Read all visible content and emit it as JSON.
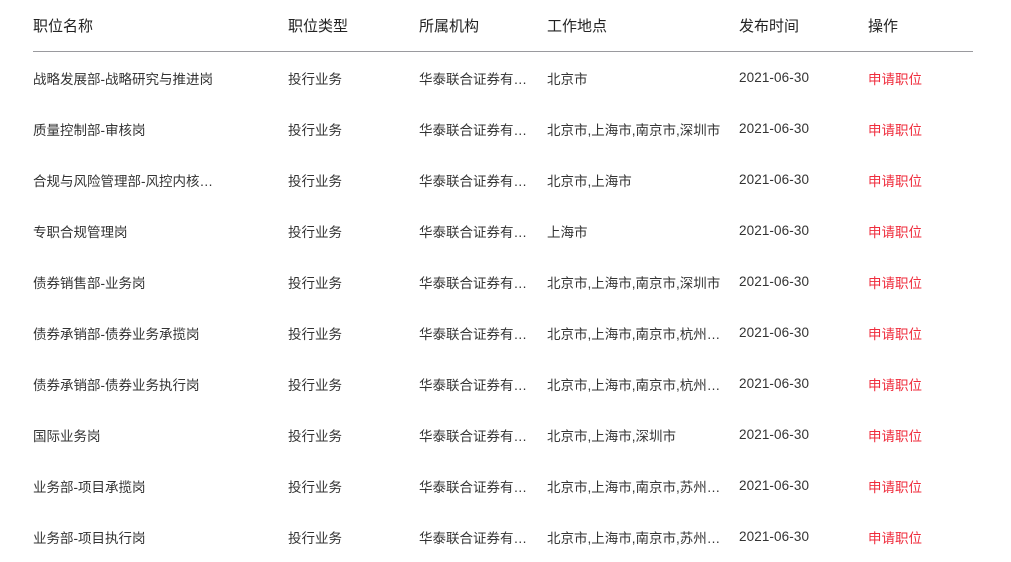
{
  "table": {
    "columns": [
      {
        "key": "title",
        "label": "职位名称"
      },
      {
        "key": "type",
        "label": "职位类型"
      },
      {
        "key": "org",
        "label": "所属机构"
      },
      {
        "key": "loc",
        "label": "工作地点"
      },
      {
        "key": "date",
        "label": "发布时间"
      },
      {
        "key": "action",
        "label": "操作"
      }
    ],
    "action_label": "申请职位",
    "accent_color": "#ef2c3c",
    "header_rule_color": "#9a9a9e",
    "rows": [
      {
        "title": "战略发展部-战略研究与推进岗",
        "type": "投行业务",
        "org": "华泰联合证券有…",
        "loc": "北京市",
        "date": "2021-06-30",
        "action": "申请职位"
      },
      {
        "title": "质量控制部-审核岗",
        "type": "投行业务",
        "org": "华泰联合证券有…",
        "loc": "北京市,上海市,南京市,深圳市",
        "date": "2021-06-30",
        "action": "申请职位"
      },
      {
        "title": "合规与风险管理部-风控内核…",
        "type": "投行业务",
        "org": "华泰联合证券有…",
        "loc": "北京市,上海市",
        "date": "2021-06-30",
        "action": "申请职位"
      },
      {
        "title": "专职合规管理岗",
        "type": "投行业务",
        "org": "华泰联合证券有…",
        "loc": "上海市",
        "date": "2021-06-30",
        "action": "申请职位"
      },
      {
        "title": "债券销售部-业务岗",
        "type": "投行业务",
        "org": "华泰联合证券有…",
        "loc": "北京市,上海市,南京市,深圳市",
        "date": "2021-06-30",
        "action": "申请职位"
      },
      {
        "title": "债券承销部-债券业务承揽岗",
        "type": "投行业务",
        "org": "华泰联合证券有…",
        "loc": "北京市,上海市,南京市,杭州…",
        "date": "2021-06-30",
        "action": "申请职位"
      },
      {
        "title": "债券承销部-债券业务执行岗",
        "type": "投行业务",
        "org": "华泰联合证券有…",
        "loc": "北京市,上海市,南京市,杭州…",
        "date": "2021-06-30",
        "action": "申请职位"
      },
      {
        "title": "国际业务岗",
        "type": "投行业务",
        "org": "华泰联合证券有…",
        "loc": "北京市,上海市,深圳市",
        "date": "2021-06-30",
        "action": "申请职位"
      },
      {
        "title": "业务部-项目承揽岗",
        "type": "投行业务",
        "org": "华泰联合证券有…",
        "loc": "北京市,上海市,南京市,苏州…",
        "date": "2021-06-30",
        "action": "申请职位"
      },
      {
        "title": "业务部-项目执行岗",
        "type": "投行业务",
        "org": "华泰联合证券有…",
        "loc": "北京市,上海市,南京市,苏州…",
        "date": "2021-06-30",
        "action": "申请职位"
      }
    ]
  }
}
